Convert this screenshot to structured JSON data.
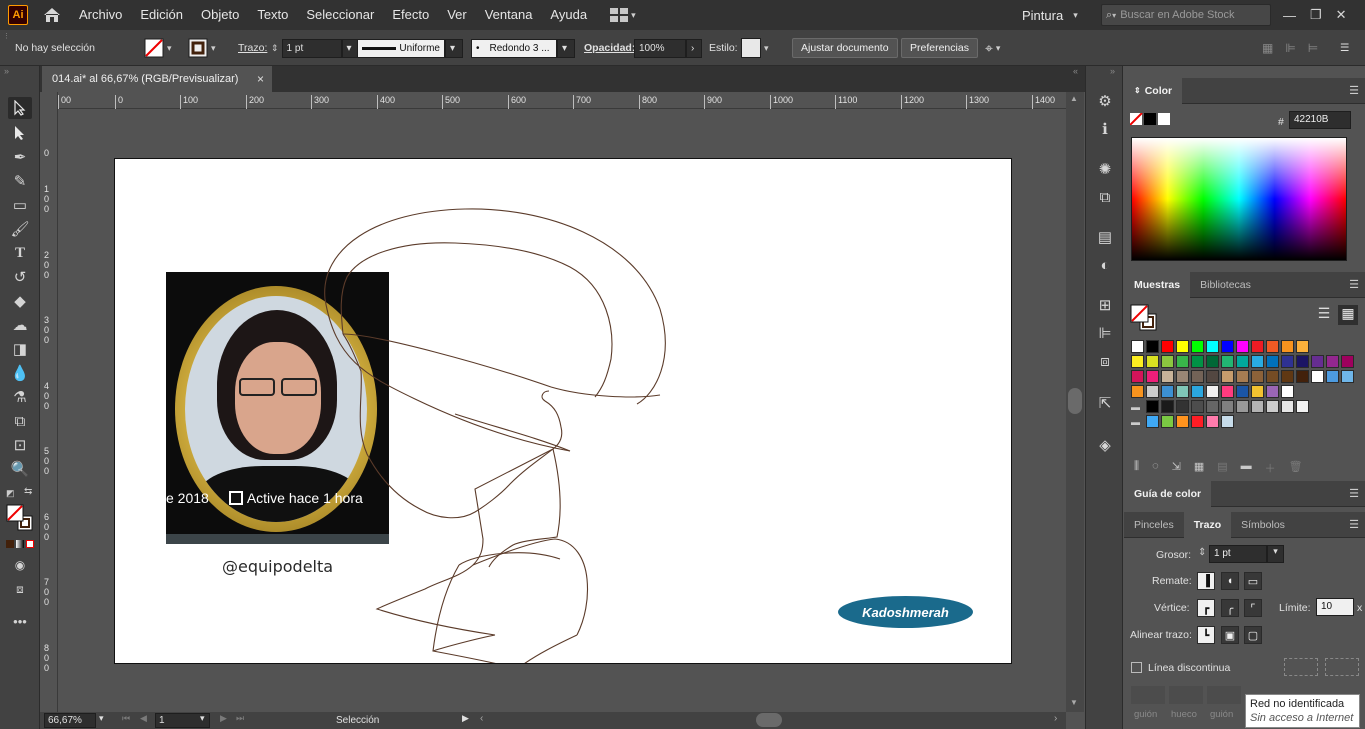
{
  "app": {
    "logo": "Ai",
    "menu": [
      "Archivo",
      "Edición",
      "Objeto",
      "Texto",
      "Seleccionar",
      "Efecto",
      "Ver",
      "Ventana",
      "Ayuda"
    ],
    "workspace": "Pintura",
    "search_placeholder": "Buscar en Adobe Stock"
  },
  "control": {
    "selection_status": "No hay selección",
    "stroke_label": "Trazo:",
    "stroke_weight": "1 pt",
    "profile": "Uniforme",
    "brush": "Redondo 3 ...",
    "opacity_label": "Opacidad:",
    "opacity": "100%",
    "style_label": "Estilo:",
    "fit_button": "Ajustar documento",
    "prefs_button": "Preferencias"
  },
  "document": {
    "tab_title": "014.ai* al 66,67% (RGB/Previsualizar)",
    "close": "×"
  },
  "ruler": {
    "h_labels": [
      "00",
      "0",
      "100",
      "200",
      "300",
      "400",
      "500",
      "600",
      "700",
      "800",
      "900",
      "1000",
      "1100",
      "1200",
      "1300",
      "1400"
    ],
    "v_labels": [
      "0",
      "1\n0\n0",
      "2\n0\n0",
      "3\n0\n0",
      "4\n0\n0",
      "5\n0\n0",
      "6\n0\n0",
      "7\n0\n0",
      "8\n0\n0"
    ]
  },
  "artwork": {
    "photo_overlay_left": "e 2018",
    "photo_overlay_right": "Active hace 1 hora",
    "handle": "@equipodelta",
    "signature": "Kadoshmerah",
    "stroke_color": "#42210B"
  },
  "status": {
    "zoom": "66,67%",
    "artboard": "1",
    "tool": "Selección"
  },
  "panels": {
    "color": {
      "title": "Color",
      "hex_symbol": "#",
      "hex": "42210B"
    },
    "swatches": {
      "tabs": [
        "Muestras",
        "Bibliotecas"
      ],
      "rows": [
        [
          "#ffffff",
          "#000000",
          "#ff0000",
          "#ffff00",
          "#00ff00",
          "#00ffff",
          "#0000ff",
          "#ff00ff",
          "#ed1c24",
          "#f15a24",
          "#f7931e",
          "#fbb03b"
        ],
        [
          "#fcee21",
          "#d9e021",
          "#8cc63f",
          "#39b54a",
          "#009245",
          "#006837",
          "#22b573",
          "#00a99d",
          "#29abe2",
          "#0071bc",
          "#2e3192",
          "#1b1464",
          "#662d91",
          "#93278f",
          "#9e005d"
        ],
        [
          "#d4145a",
          "#ed1e79",
          "#c7b299",
          "#998675",
          "#736357",
          "#534741",
          "#c69c6d",
          "#a67c52",
          "#8c6239",
          "#754c24",
          "#603813",
          "#42210b",
          "#ffffff",
          "#4d9be0",
          "#6fb6e9"
        ],
        [
          "#f7931e",
          "#cccccc",
          "#3c8fd1",
          "#7fc6b8",
          "#2ba6de",
          "#f0f0f0",
          "#ff3b7f",
          "#1a55a6",
          "#f2c230",
          "#9a66b5",
          "#ffffff"
        ],
        [
          "#000000",
          "#1a1a1a",
          "#333333",
          "#4d4d4d",
          "#666666",
          "#808080",
          "#999999",
          "#b3b3b3",
          "#cccccc",
          "#e6e6e6",
          "#f2f2f2"
        ],
        [
          "#3fa9f5",
          "#7ac943",
          "#ff931e",
          "#ff1d25",
          "#ff7bac",
          "#c7dcea"
        ]
      ]
    },
    "color_guide": {
      "title": "Guía de color"
    },
    "stroke": {
      "tabs": [
        "Pinceles",
        "Trazo",
        "Símbolos"
      ],
      "weight_label": "Grosor:",
      "weight": "1 pt",
      "cap_label": "Remate:",
      "corner_label": "Vértice:",
      "limit_label": "Límite:",
      "limit": "10",
      "limit_unit": "x",
      "align_label": "Alinear trazo:",
      "dashed_label": "Línea discontinua",
      "dash_labels": [
        "guión",
        "hueco",
        "guión",
        "hueco",
        "guión",
        "hueco"
      ]
    }
  },
  "tooltip": {
    "line1": "Red no identificada",
    "line2": "Sin acceso a Internet"
  }
}
